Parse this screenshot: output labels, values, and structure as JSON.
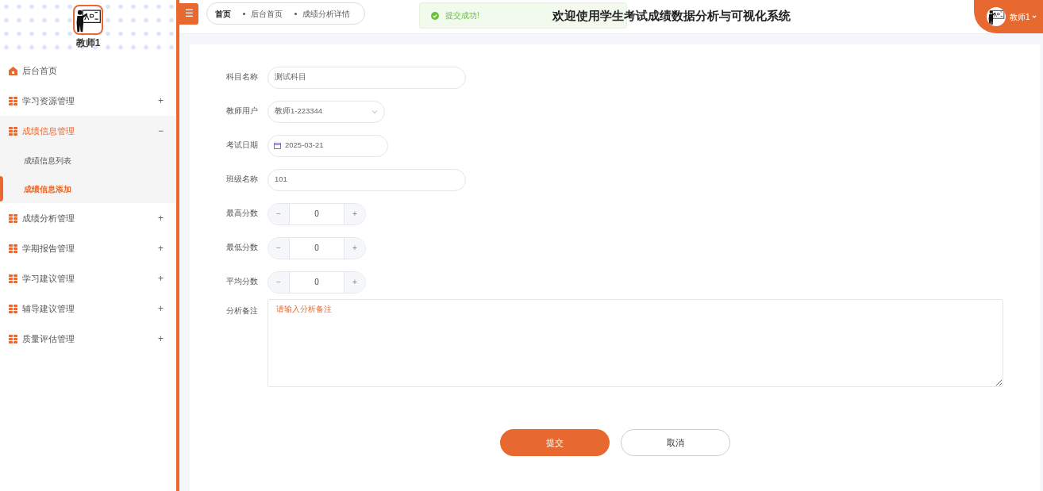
{
  "sidebar": {
    "user_name": "教师1",
    "menu": [
      {
        "label": "后台首页",
        "kind": "home",
        "selected": false
      },
      {
        "label": "学习资源管理",
        "kind": "group",
        "expanded": false,
        "sign": "+"
      },
      {
        "label": "成绩信息管理",
        "kind": "group",
        "expanded": true,
        "sign": "−",
        "children": [
          {
            "label": "成绩信息列表",
            "selected": false
          },
          {
            "label": "成绩信息添加",
            "selected": true
          }
        ]
      },
      {
        "label": "成绩分析管理",
        "kind": "group",
        "expanded": false,
        "sign": "+"
      },
      {
        "label": "学期报告管理",
        "kind": "group",
        "expanded": false,
        "sign": "+"
      },
      {
        "label": "学习建议管理",
        "kind": "group",
        "expanded": false,
        "sign": "+"
      },
      {
        "label": "辅导建议管理",
        "kind": "group",
        "expanded": false,
        "sign": "+"
      },
      {
        "label": "质量评估管理",
        "kind": "group",
        "expanded": false,
        "sign": "+"
      }
    ]
  },
  "header": {
    "menu_toggle": "☰",
    "breadcrumb": [
      "首页",
      "后台首页",
      "成绩分析详情"
    ],
    "title": "欢迎使用学生考试成绩数据分析与可视化系统",
    "toast": "提交成功!",
    "user_name": "教师1"
  },
  "form": {
    "fields": [
      {
        "label": "科目名称",
        "kind": "text",
        "value": "测试科目"
      },
      {
        "label": "教师用户",
        "kind": "select",
        "value": "教师1-223344"
      },
      {
        "label": "考试日期",
        "kind": "date",
        "value": "2025-03-21"
      },
      {
        "label": "班级名称",
        "kind": "text",
        "value": "101"
      },
      {
        "label": "最高分数",
        "kind": "number",
        "value": "0",
        "minus": "−",
        "plus": "+"
      },
      {
        "label": "最低分数",
        "kind": "number",
        "value": "0",
        "minus": "−",
        "plus": "+"
      },
      {
        "label": "平均分数",
        "kind": "number",
        "value": "0",
        "minus": "−",
        "plus": "+"
      },
      {
        "label": "分析备注",
        "kind": "textarea",
        "placeholder": "请输入分析备注"
      }
    ],
    "buttons": [
      {
        "label": "提交",
        "kind": "primary"
      },
      {
        "label": "取消",
        "kind": "secondary"
      }
    ]
  }
}
